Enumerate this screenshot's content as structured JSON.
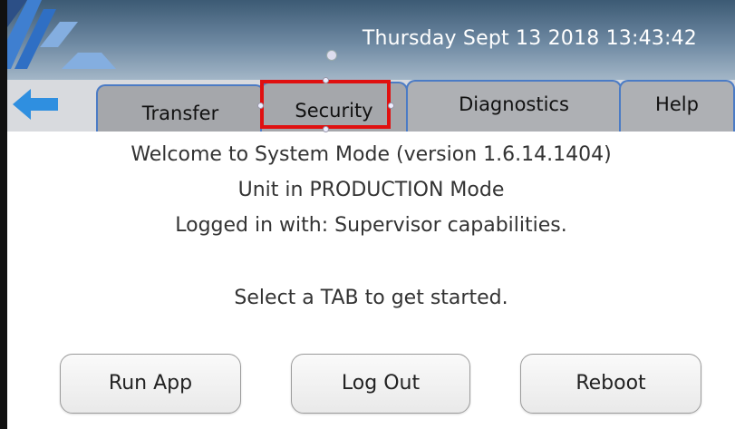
{
  "header": {
    "datetime": "Thursday Sept 13 2018 13:43:42"
  },
  "tabs": [
    {
      "label": "Transfer"
    },
    {
      "label": "Security"
    },
    {
      "label": "Diagnostics"
    },
    {
      "label": "Help"
    }
  ],
  "main": {
    "welcome": "Welcome to System Mode (version 1.6.14.1404)",
    "mode": "Unit in PRODUCTION Mode",
    "login": "Logged in with: Supervisor capabilities.",
    "prompt": "Select a TAB to get started."
  },
  "buttons": {
    "run_app": "Run App",
    "log_out": "Log Out",
    "reboot": "Reboot"
  },
  "colors": {
    "header_dark": "#3c5a74",
    "tab_border": "#4b7bc5",
    "tab_fill": "#a5a7ab",
    "highlight": "#e01010",
    "back_arrow": "#2f8fe0"
  }
}
